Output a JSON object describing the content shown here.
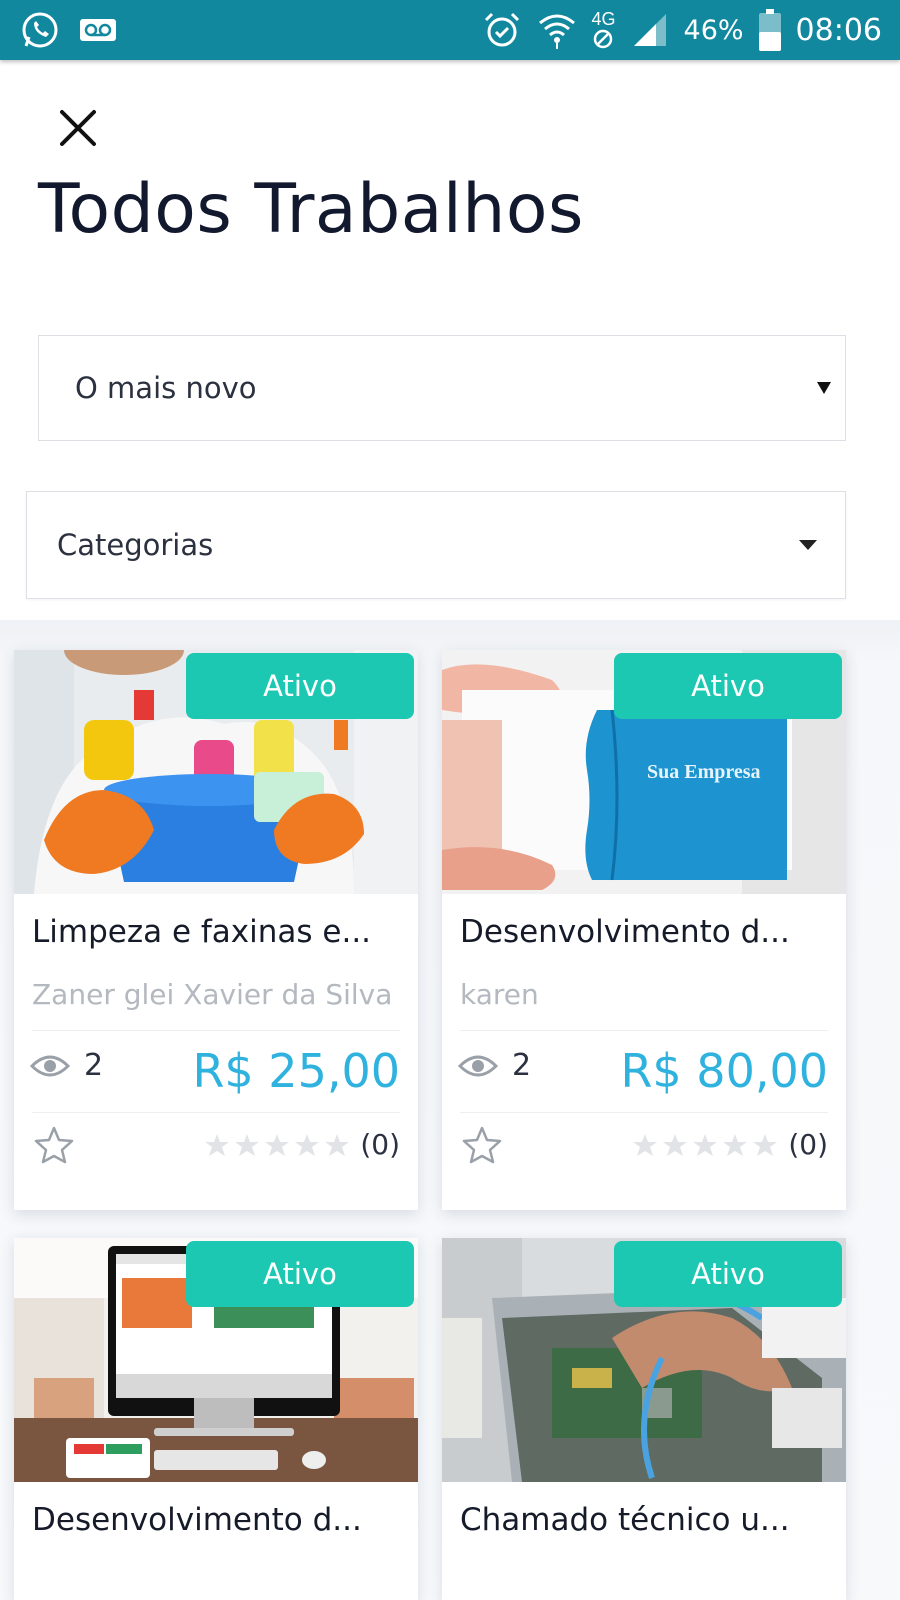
{
  "status_bar": {
    "battery": "46%",
    "time": "08:06",
    "network": "4G"
  },
  "colors": {
    "status_bar": "#12889f",
    "badge": "#1dc8b3",
    "price": "#2fb2de"
  },
  "header": {
    "close_icon": "close-icon",
    "title": "Todos Trabalhos"
  },
  "filters": {
    "sort": {
      "selected": "O mais novo"
    },
    "category": {
      "selected": "Categorias"
    }
  },
  "jobs": [
    {
      "status": "Ativo",
      "title": "Limpeza e faxinas e...",
      "author": "Zaner glei Xavier da Silva",
      "views": "2",
      "price": "R$ 25,00",
      "rating_count": "(0)",
      "rating": 0
    },
    {
      "status": "Ativo",
      "title": "Desenvolvimento d...",
      "author": "karen",
      "views": "2",
      "price": "R$ 80,00",
      "rating_count": "(0)",
      "rating": 0,
      "image_text": "Sua Empresa"
    },
    {
      "status": "Ativo",
      "title": "Desenvolvimento d..."
    },
    {
      "status": "Ativo",
      "title": "Chamado técnico u..."
    }
  ]
}
